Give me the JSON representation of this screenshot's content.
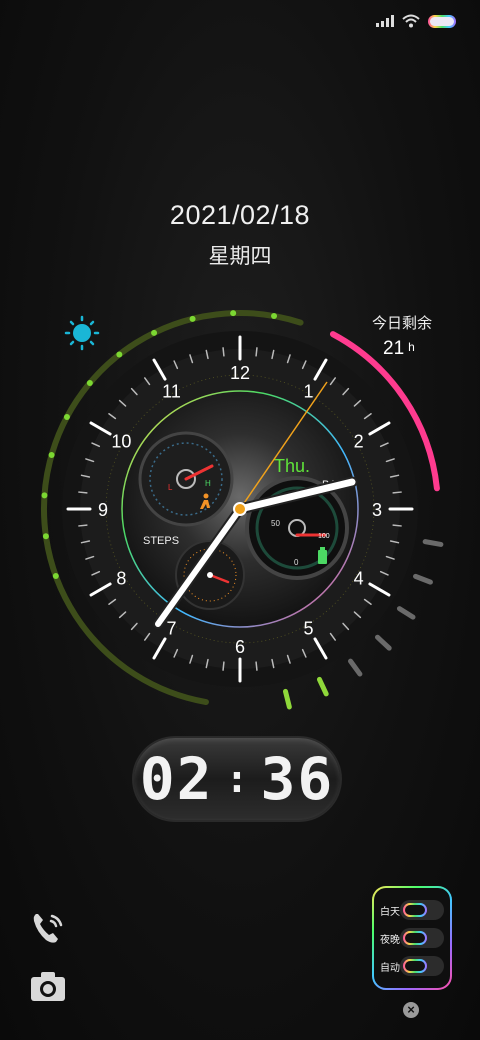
{
  "status_bar": {
    "signal_icon": "signal-bars-icon",
    "wifi_icon": "wifi-icon",
    "battery_icon": "battery-icon"
  },
  "date": "2021/02/18",
  "weekday": "星期四",
  "remaining": {
    "label": "今日剩余",
    "value": "21",
    "unit": "h"
  },
  "clock": {
    "numerals": [
      "12",
      "1",
      "2",
      "3",
      "4",
      "5",
      "6",
      "7",
      "8",
      "9",
      "10",
      "11"
    ],
    "day_label": "Thu.",
    "bat_label": "BAT",
    "steps_label": "STEPS",
    "steps_high": "H",
    "steps_low": "L",
    "bat_scale": [
      "50",
      "100",
      "0"
    ],
    "hands": {
      "hour": "2",
      "minute": "36"
    },
    "brightness_icon": "sun-icon"
  },
  "digital_time": {
    "hours": "02",
    "minutes": "36"
  },
  "shortcuts": {
    "phone_icon": "phone-icon",
    "camera_icon": "camera-icon"
  },
  "mode_panel": {
    "items": [
      {
        "label": "白天"
      },
      {
        "label": "夜晚"
      },
      {
        "label": "自动"
      }
    ],
    "close_icon": "close-icon",
    "close_glyph": "×"
  },
  "colors": {
    "accent_green": "#7cd832",
    "accent_pink": "#ff3b8f",
    "sun_blue": "#1ab6d6"
  }
}
